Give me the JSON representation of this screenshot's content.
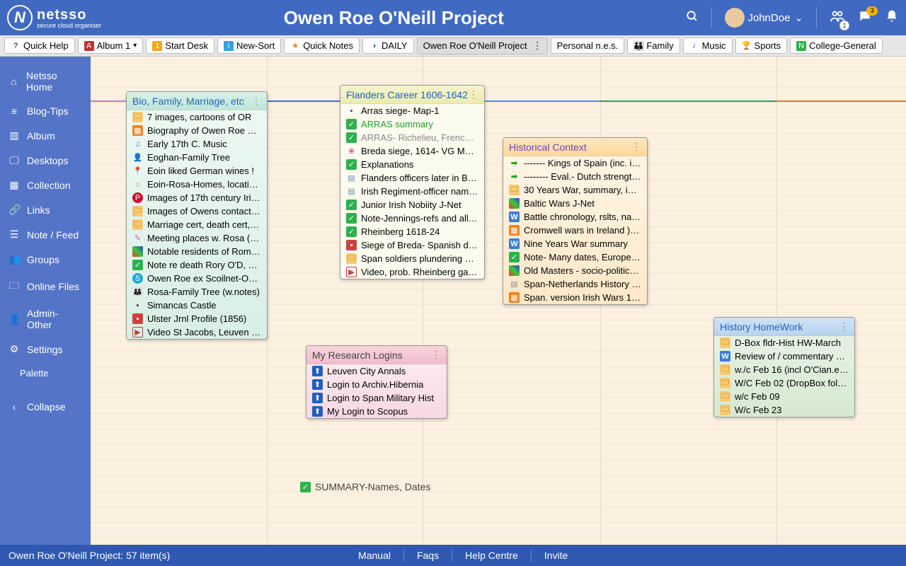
{
  "header": {
    "logo_name": "netsso",
    "logo_sub": "secure cloud organiser",
    "title": "Owen Roe O'Neill Project",
    "user": "JohnDoe",
    "notif_count": "3",
    "people_count": "1"
  },
  "tabs": [
    {
      "label": "Quick Help",
      "icon_bg": "",
      "icon": "?",
      "ico_class": ""
    },
    {
      "label": "Album 1",
      "icon": "A",
      "ico_class": "ic-album",
      "dropdown": true
    },
    {
      "label": "Start Desk",
      "icon": "1",
      "ico_class": "ic-orange-sq"
    },
    {
      "label": "New-Sort",
      "icon": "i",
      "ico_class": "ic-sort"
    },
    {
      "label": "Quick Notes",
      "icon": "★",
      "ico_class": "ic-star"
    },
    {
      "label": "DAILY",
      "icon": "◑",
      "ico_class": "ic-target"
    },
    {
      "label": "Owen Roe O'Neill Project",
      "active": true,
      "options": true
    },
    {
      "label": "Personal n.e.s."
    },
    {
      "label": "Family",
      "icon": "👪",
      "ico_class": "ic-family"
    },
    {
      "label": "Music",
      "icon": "♪",
      "ico_class": "ic-music-blue"
    },
    {
      "label": "Sports",
      "icon": "🏆",
      "ico_class": "ic-trophy"
    },
    {
      "label": "College-General",
      "icon": "N",
      "ico_class": "ic-n"
    }
  ],
  "sidebar": [
    {
      "label": "Netsso Home",
      "icon": "⌂"
    },
    {
      "label": "Blog-Tips",
      "icon": "≡"
    },
    {
      "label": "Album",
      "icon": "▥"
    },
    {
      "label": "Desktops",
      "icon": "🖵"
    },
    {
      "label": "Collection",
      "icon": "▦"
    },
    {
      "label": "Links",
      "icon": "🔗"
    },
    {
      "label": "Note / Feed",
      "icon": "☰"
    },
    {
      "label": "Groups",
      "icon": "👥"
    },
    {
      "label": "Online Files",
      "icon": "🗀"
    },
    {
      "label": "Admin-Other",
      "icon": "👤"
    },
    {
      "label": "Settings",
      "icon": "⚙"
    }
  ],
  "sidebar_palette": "Palette",
  "sidebar_collapse": "Collapse",
  "cards": {
    "bio": {
      "title": "Bio, Family, Marriage, etc",
      "items": [
        {
          "t": "7 images, cartoons of OR",
          "c": "ic-folder",
          "i": "🗀"
        },
        {
          "t": "Biography of Owen Roe O'Neill",
          "c": "ic-orange",
          "i": "▦"
        },
        {
          "t": "Early 17th C. Music",
          "c": "",
          "i": "♫",
          "style": "color:#5080d0"
        },
        {
          "t": "Eoghan-Family Tree",
          "c": "",
          "i": "👤",
          "style": "color:#5a8a5a"
        },
        {
          "t": "Eoin liked German wines !",
          "c": "",
          "i": "📍",
          "style": "color:#18a818"
        },
        {
          "t": "Eoin-Rosa-Homes, locations, c...",
          "c": "",
          "i": "⌂",
          "style": "color:#c08040"
        },
        {
          "t": "Images of 17th century Irish c...",
          "c": "",
          "i": "P",
          "style": "background:#c8102e;color:white;border-radius:50%"
        },
        {
          "t": "Images of Owens contacts (Ol...",
          "c": "ic-folder",
          "i": "🗀"
        },
        {
          "t": "Marriage cert, death cert, othe...",
          "c": "ic-folder",
          "i": "🗀"
        },
        {
          "t": "Meeting places w. Rosa (secret)",
          "c": "ic-pen",
          "i": "✎"
        },
        {
          "t": "Notable residents of Rome (16...",
          "c": "ic-mixed",
          "i": " "
        },
        {
          "t": "Note re death Rory O'D, arrival...",
          "c": "ic-note",
          "i": "✓"
        },
        {
          "t": "Owen Roe ex Scoilnet-Only Lin...",
          "c": "ic-s",
          "i": "S"
        },
        {
          "t": "Rosa-Family Tree (w.notes)",
          "c": "",
          "i": "👪"
        },
        {
          "t": "Simancas Castle",
          "c": "",
          "i": "▪",
          "style": "color:#333"
        },
        {
          "t": "Ulster Jrnl Profile (1856)",
          "c": "ic-red",
          "i": "▪"
        },
        {
          "t": "Video St Jacobs, Leuven (marri...",
          "c": "ic-play",
          "i": "▶"
        }
      ]
    },
    "flanders": {
      "title": "Flanders Career 1606-1642",
      "items": [
        {
          "t": "Arras siege- Map-1",
          "c": "",
          "i": "▪",
          "style": "color:#2050a0"
        },
        {
          "t": "ARRAS summary",
          "c": "ic-note",
          "i": "✓",
          "txt_style": "color:#20a020"
        },
        {
          "t": "ARRAS- Richelieu, French view",
          "c": "ic-note",
          "i": "✓",
          "txt_style": "color:#888"
        },
        {
          "t": "Breda siege, 1614- VG Map- N...",
          "c": "",
          "i": "❀",
          "style": "color:#d06090"
        },
        {
          "t": "Explanations",
          "c": "ic-note",
          "i": "✓"
        },
        {
          "t": "Flanders officers later in Benbu...",
          "c": "ic-book",
          "i": "▤"
        },
        {
          "t": "Irish Regiment-officer names, ...",
          "c": "ic-book",
          "i": "▤"
        },
        {
          "t": "Junior Irish Nobiity J-Net",
          "c": "ic-note",
          "i": "✓"
        },
        {
          "t": "Note-Jennings-refs and all dates",
          "c": "ic-note",
          "i": "✓"
        },
        {
          "t": "Rheinberg 1618-24",
          "c": "ic-note",
          "i": "✓"
        },
        {
          "t": "Siege of Breda- Spanish descry...",
          "c": "ic-red",
          "i": "▪"
        },
        {
          "t": "Span soldiers plundering Wom...",
          "c": "ic-folder",
          "i": "🗀"
        },
        {
          "t": "Video, prob. Rheinberg garrison",
          "c": "ic-play",
          "i": "▶"
        }
      ]
    },
    "hist": {
      "title": "Historical Context",
      "items": [
        {
          "t": "------- Kings of Spain (inc. ima...",
          "c": "ic-green-arrow",
          "i": "➡"
        },
        {
          "t": "-------- Eval.- Dutch strengths",
          "c": "ic-green-arrow",
          "i": "➡"
        },
        {
          "t": "30 Years War, summary, imag...",
          "c": "ic-folder",
          "i": "🗀"
        },
        {
          "t": "Baltic Wars J-Net",
          "c": "ic-mixed",
          "i": " "
        },
        {
          "t": "Battle chronology, rslts, names...",
          "c": "ic-word",
          "i": "W"
        },
        {
          "t": "Cromwell wars in Ireland )Sp.)",
          "c": "ic-orange",
          "i": "▦"
        },
        {
          "t": "Nine Years War summary",
          "c": "ic-word",
          "i": "W"
        },
        {
          "t": "Note- Many dates, Europe 160...",
          "c": "ic-note",
          "i": "✓"
        },
        {
          "t": "Old Masters - socio-political art...",
          "c": "ic-mixed",
          "i": " "
        },
        {
          "t": "Span-Netherlands History fldr (...",
          "c": "ic-doc",
          "i": "▤"
        },
        {
          "t": "Span. version Irish Wars 16th-...",
          "c": "ic-orange",
          "i": "▦"
        }
      ]
    },
    "logins": {
      "title": "My Research Logins",
      "items": [
        {
          "t": "Leuven City Annals",
          "c": "ic-blue",
          "i": "⬆"
        },
        {
          "t": "Login to Archiv.Hibernia",
          "c": "ic-blue",
          "i": "⬆"
        },
        {
          "t": "Login to Span Military Hist",
          "c": "ic-blue",
          "i": "⬆"
        },
        {
          "t": "My Login to Scopus",
          "c": "ic-blue",
          "i": "⬆"
        }
      ]
    },
    "hw": {
      "title": "History HomeWork",
      "items": [
        {
          "t": "D-Box fldr-Hist HW-March",
          "c": "ic-folder",
          "i": "🗀"
        },
        {
          "t": "Review of / commentary on O'...",
          "c": "ic-word",
          "i": "W"
        },
        {
          "t": "w./c Feb 16 (incl O'Cian.essay)",
          "c": "ic-folder",
          "i": "🗀"
        },
        {
          "t": "W/C Feb 02 (DropBox folder)",
          "c": "ic-folder",
          "i": "🗀"
        },
        {
          "t": "w/c Feb 09",
          "c": "ic-folder",
          "i": "🗀"
        },
        {
          "t": "W/c Feb 23",
          "c": "ic-folder",
          "i": "🗀"
        }
      ]
    }
  },
  "lone_item": {
    "label": "SUMMARY-Names, Dates"
  },
  "footer": {
    "status": "Owen Roe O'Neill Project: 57 item(s)",
    "links": [
      "Manual",
      "Faqs",
      "Help Centre",
      "Invite"
    ]
  }
}
